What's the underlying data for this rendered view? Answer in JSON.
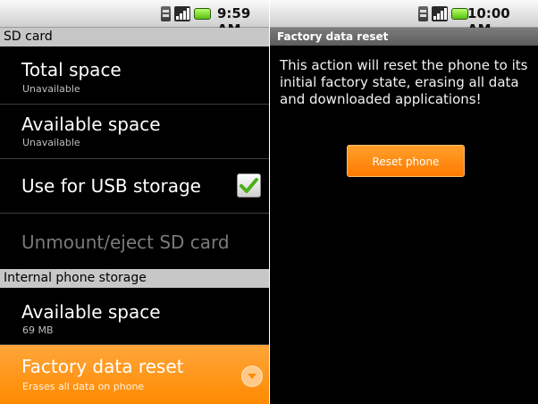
{
  "left_screen": {
    "status_bar": {
      "time": "9:59 AM"
    },
    "sd_card_header": "SD card",
    "sd_card_items": [
      {
        "title": "Total space",
        "subtitle": "Unavailable"
      },
      {
        "title": "Available space",
        "subtitle": "Unavailable"
      },
      {
        "title": "Use for USB storage",
        "checked": true
      },
      {
        "title": "Unmount/eject SD card",
        "enabled": false
      }
    ],
    "internal_header": "Internal phone storage",
    "internal_items": [
      {
        "title": "Available space",
        "subtitle": "69 MB"
      },
      {
        "title": "Factory data reset",
        "subtitle": "Erases all data on phone",
        "selected": true
      }
    ]
  },
  "right_screen": {
    "status_bar": {
      "time": "10:00 AM"
    },
    "title": "Factory data reset",
    "message": "This action will reset the phone to its initial factory state, erasing all data and downloaded applications!",
    "reset_button_label": "Reset phone"
  },
  "colors": {
    "accent": "#ff8a00",
    "check": "#4caf1a",
    "header_gray": "#c7c7c7"
  },
  "icons": [
    "sim-card-icon",
    "signal-icon",
    "battery-icon",
    "checkmark-icon",
    "chevron-down-icon"
  ]
}
